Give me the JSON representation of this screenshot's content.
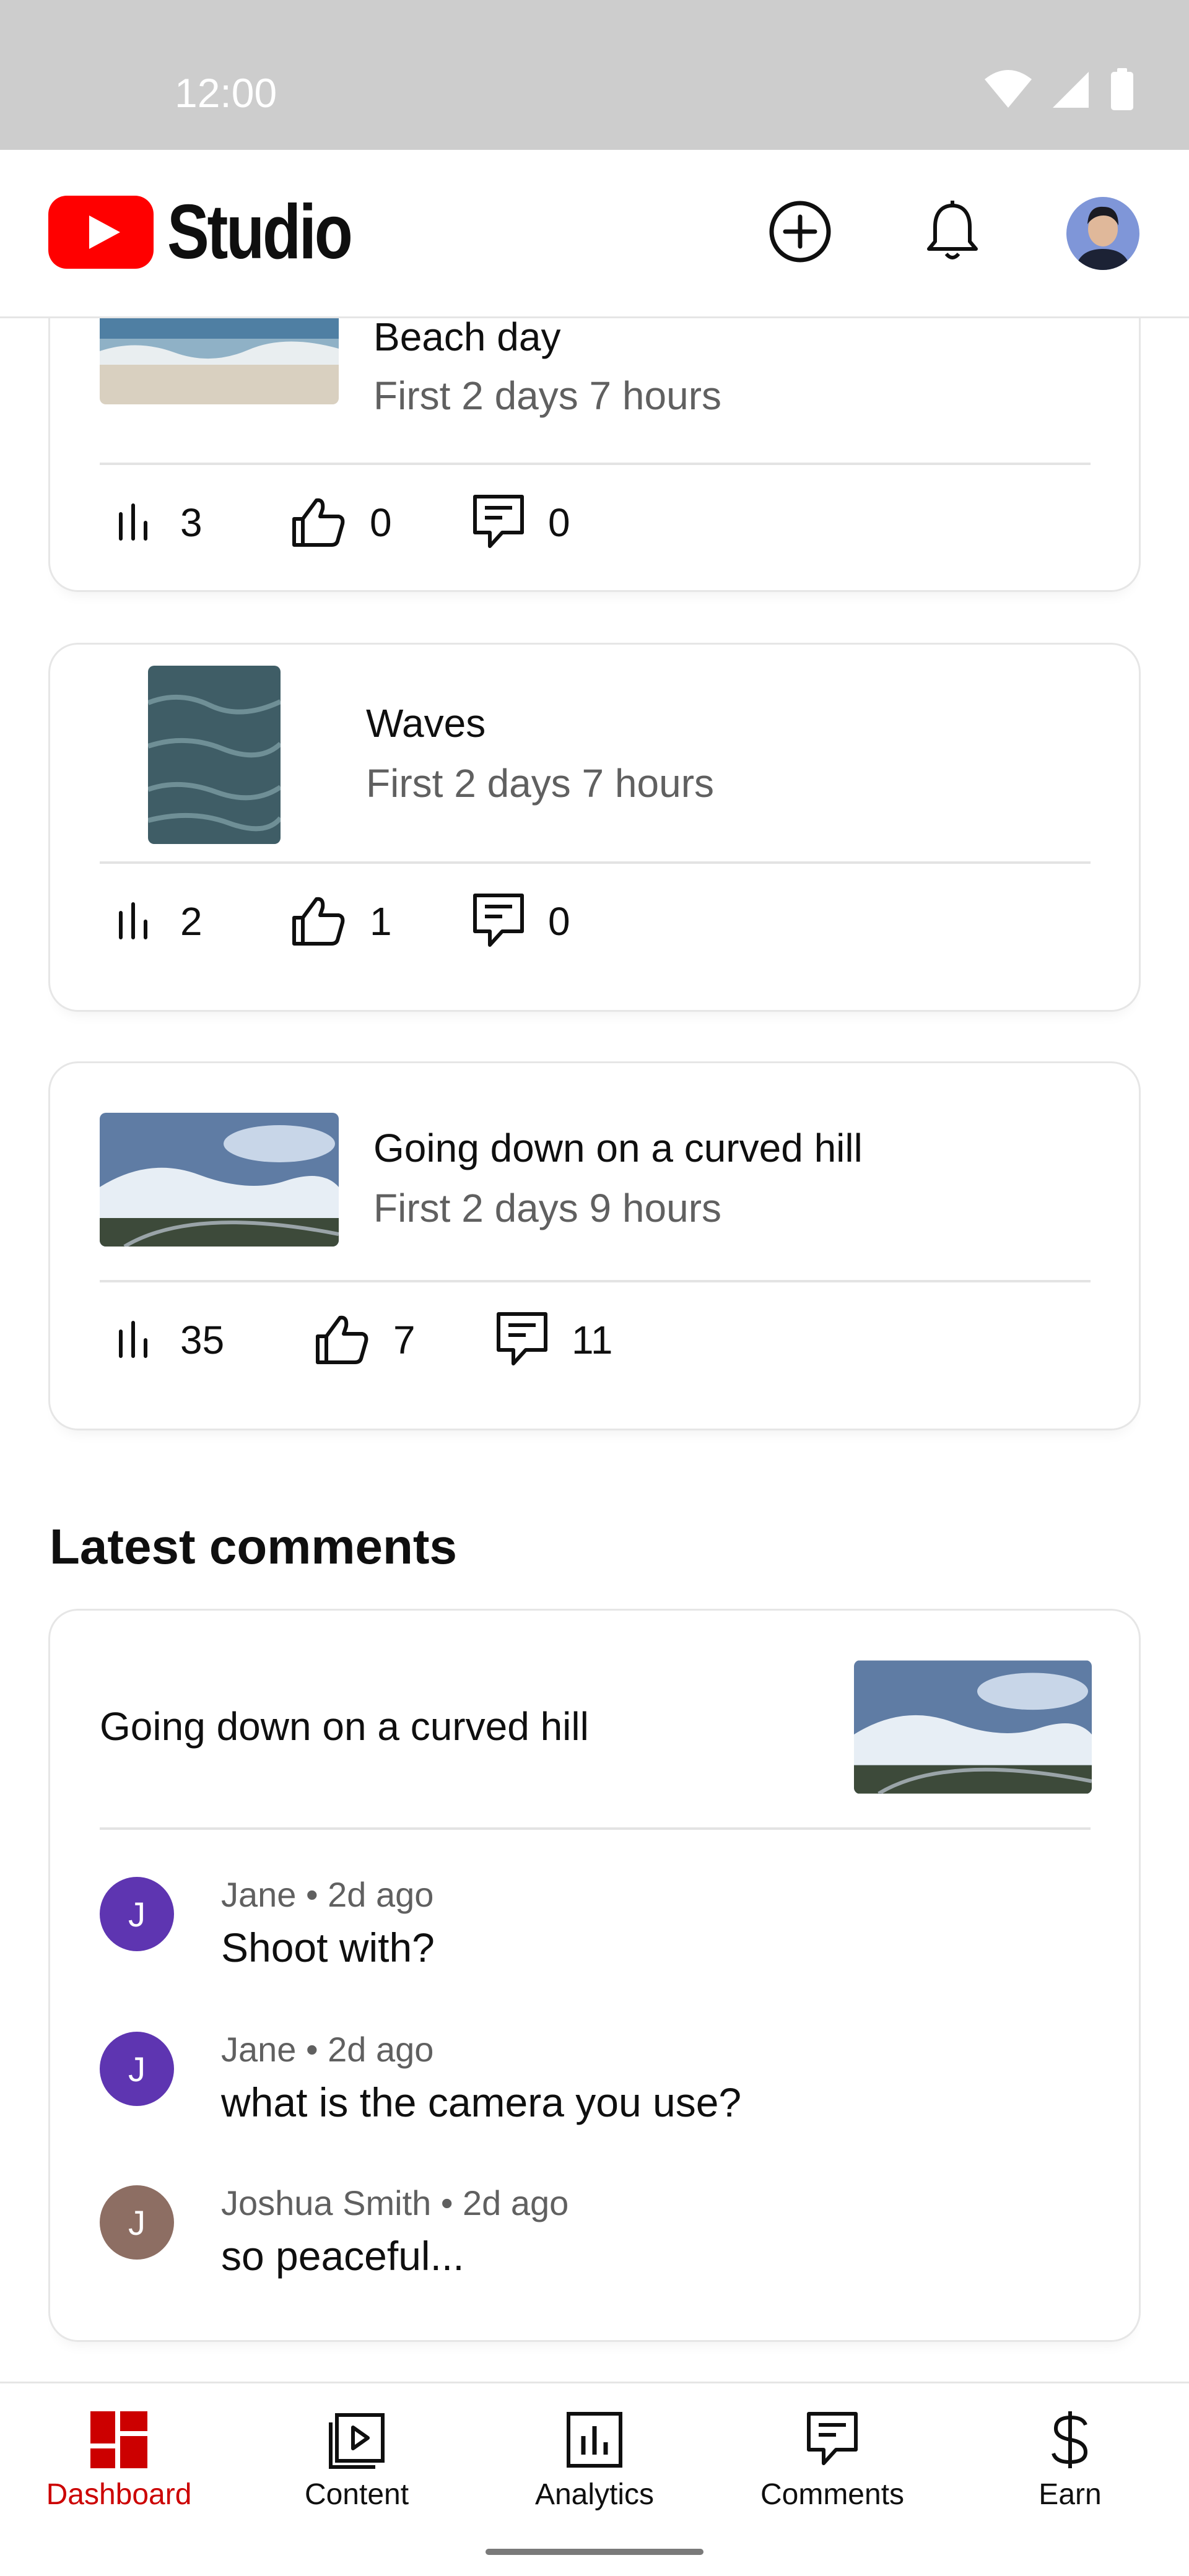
{
  "status_bar": {
    "time": "12:00"
  },
  "header": {
    "logo_text": "Studio"
  },
  "videos": [
    {
      "title": "Beach day",
      "subtitle": "First 2 days 7 hours",
      "views": "3",
      "likes": "0",
      "comments": "0"
    },
    {
      "title": "Waves",
      "subtitle": "First 2 days 7 hours",
      "views": "2",
      "likes": "1",
      "comments": "0"
    },
    {
      "title": "Going down on a curved hill",
      "subtitle": "First 2 days 9 hours",
      "views": "35",
      "likes": "7",
      "comments": "11"
    }
  ],
  "latest_comments": {
    "heading": "Latest comments",
    "video_title": "Going down on a curved hill",
    "items": [
      {
        "initial": "J",
        "meta": "Jane • 2d ago",
        "text": "Shoot with?",
        "color": "#5e35b1"
      },
      {
        "initial": "J",
        "meta": "Jane • 2d ago",
        "text": "what is the camera you use?",
        "color": "#5e35b1"
      },
      {
        "initial": "J",
        "meta": "Joshua Smith • 2d ago",
        "text": "so peaceful...",
        "color": "#8d6e63"
      }
    ]
  },
  "nav": {
    "items": [
      {
        "label": "Dashboard",
        "icon": "dashboard-icon"
      },
      {
        "label": "Content",
        "icon": "content-icon"
      },
      {
        "label": "Analytics",
        "icon": "analytics-icon"
      },
      {
        "label": "Comments",
        "icon": "comments-icon"
      },
      {
        "label": "Earn",
        "icon": "earn-icon"
      }
    ],
    "active": "Dashboard"
  },
  "colors": {
    "accent": "#cc0000",
    "youtube_red": "#ff0000",
    "text_secondary": "#606060"
  }
}
